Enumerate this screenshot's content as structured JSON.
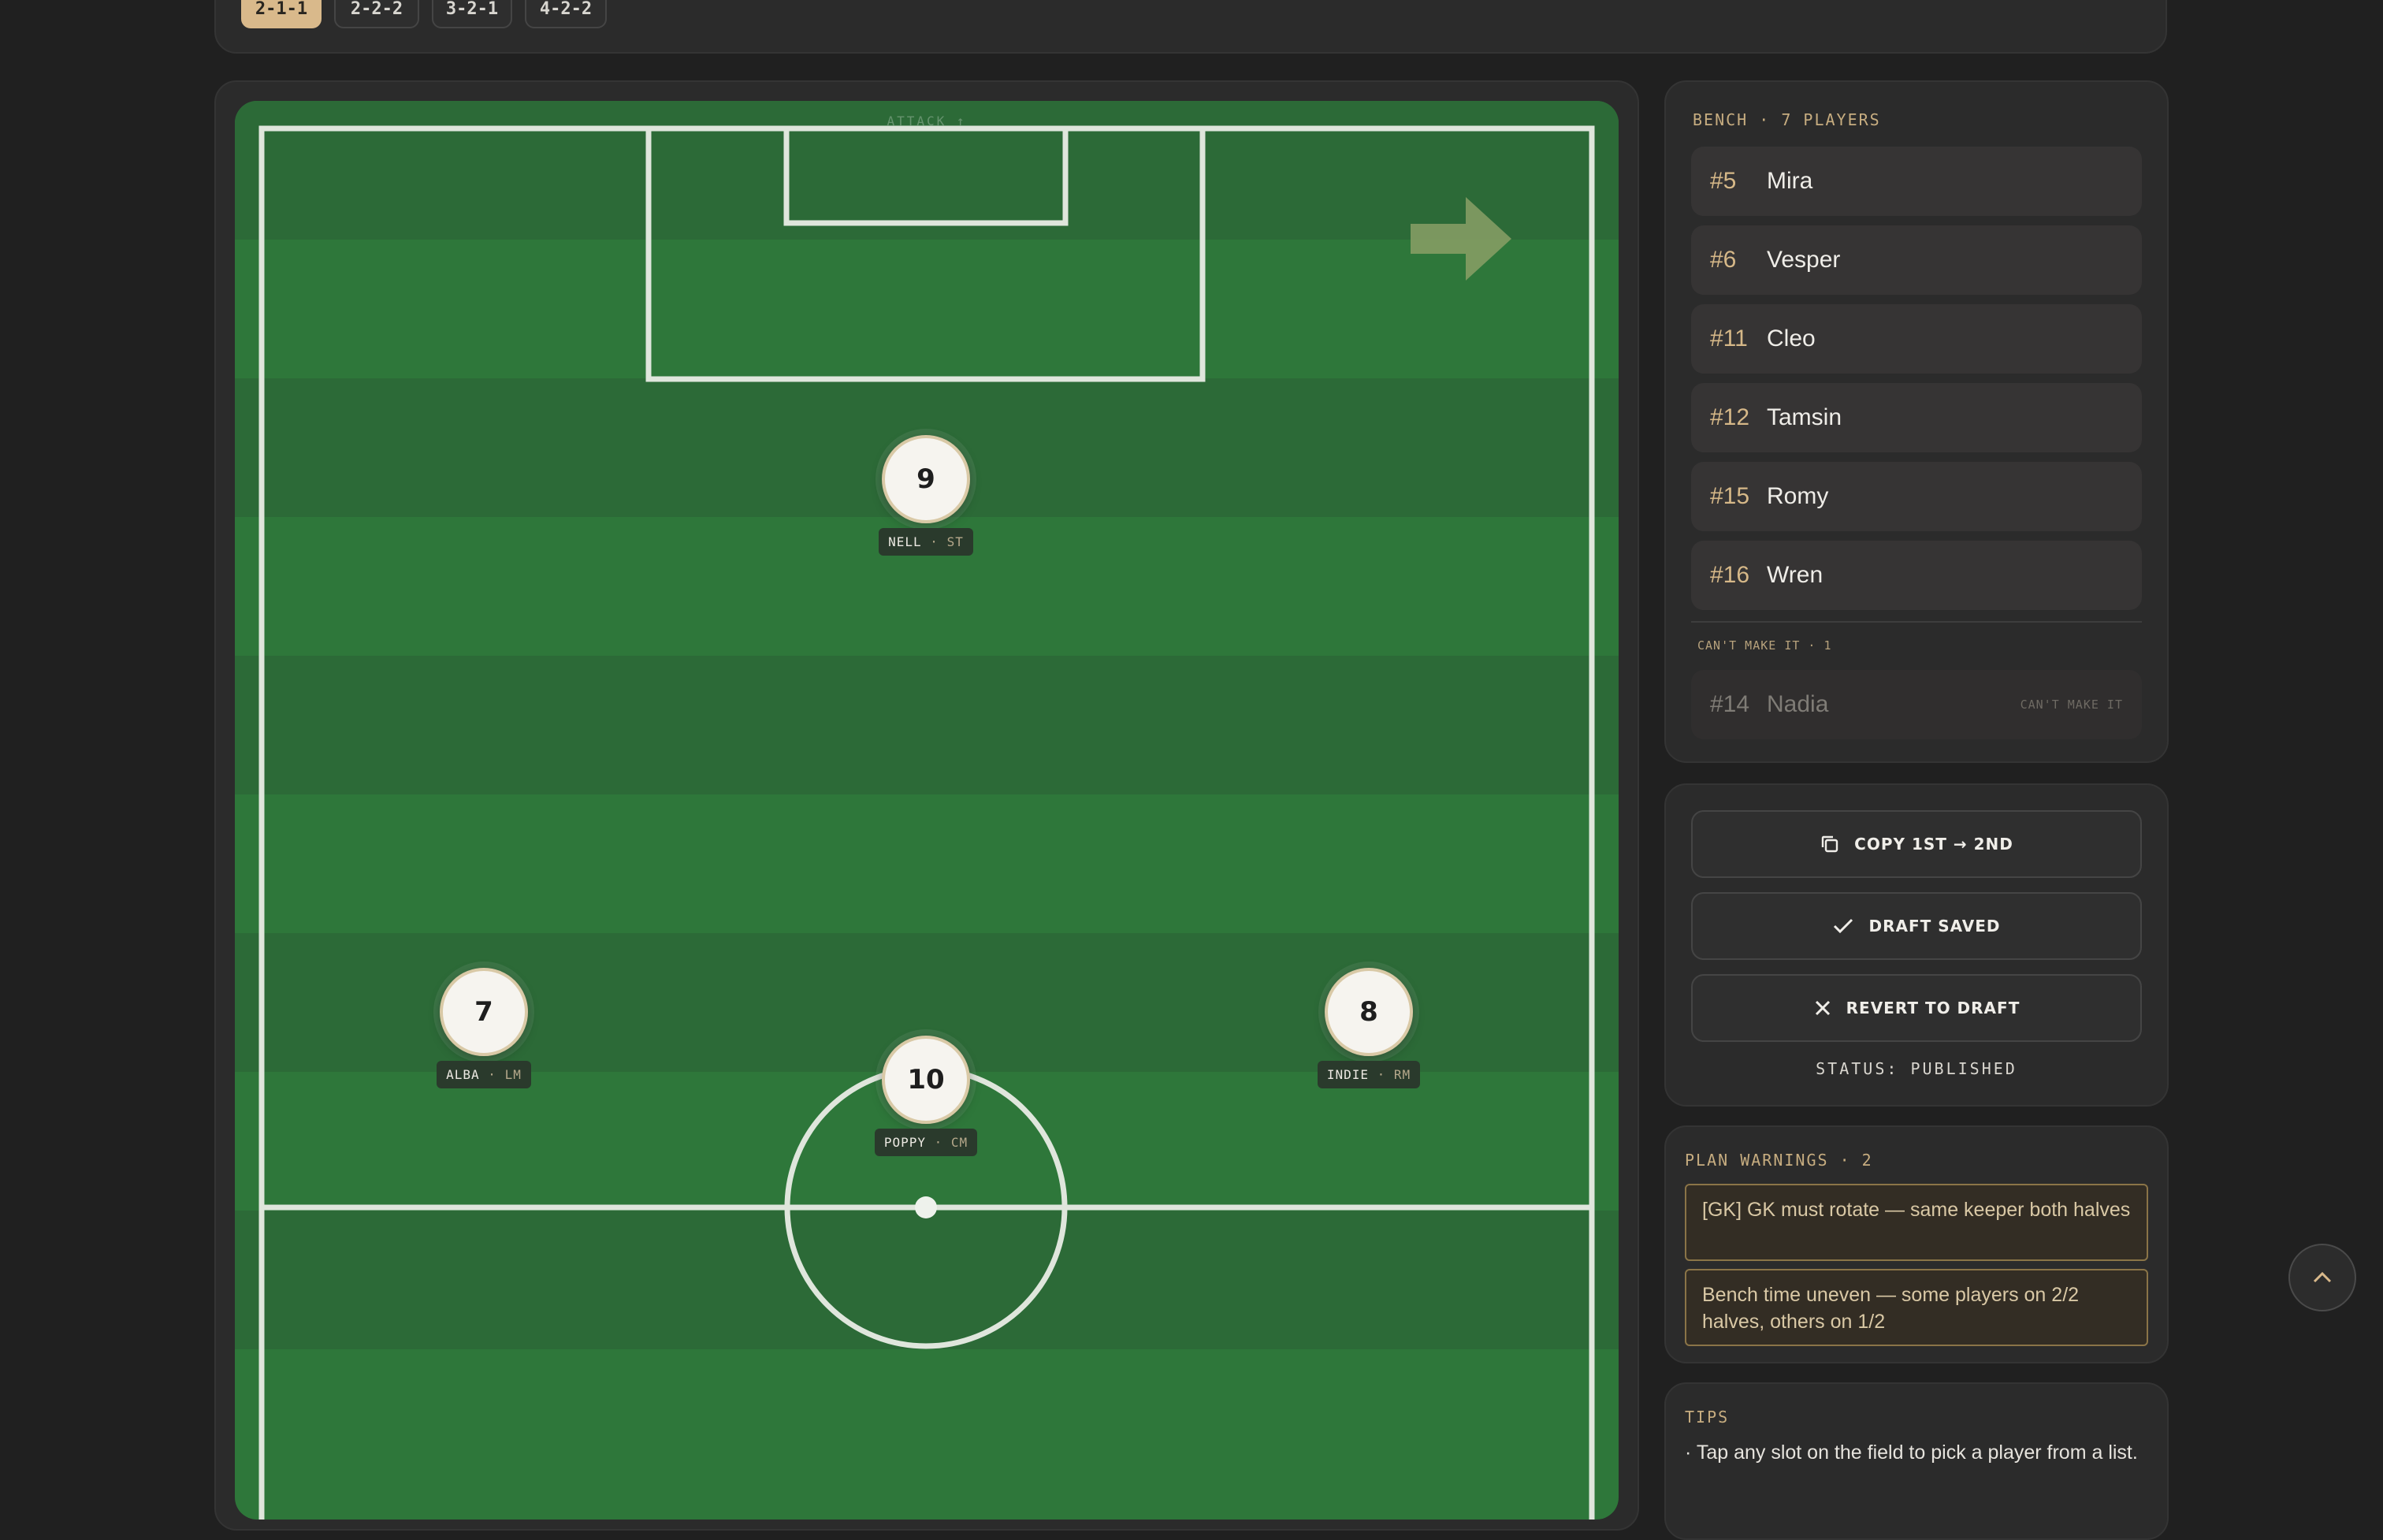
{
  "tabs": [
    {
      "label": "2-1-1"
    },
    {
      "label": "2-2-2"
    },
    {
      "label": "3-2-1"
    },
    {
      "label": "4-2-2"
    }
  ],
  "pitch": {
    "attack_label": "ATTACK ↑",
    "players": [
      {
        "number": "9",
        "name": "NELL",
        "position": "ST"
      },
      {
        "number": "7",
        "name": "ALBA",
        "position": "LM"
      },
      {
        "number": "8",
        "name": "INDIE",
        "position": "RM"
      },
      {
        "number": "10",
        "name": "POPPY",
        "position": "CM"
      }
    ],
    "separator": " · "
  },
  "bench": {
    "title": "BENCH · 7 PLAYERS",
    "players": [
      {
        "number": "#5",
        "name": "Mira"
      },
      {
        "number": "#6",
        "name": "Vesper"
      },
      {
        "number": "#11",
        "name": "Cleo"
      },
      {
        "number": "#12",
        "name": "Tamsin"
      },
      {
        "number": "#15",
        "name": "Romy"
      },
      {
        "number": "#16",
        "name": "Wren"
      }
    ],
    "unavailable_title": "CAN'T MAKE IT · 1",
    "unavailable": [
      {
        "number": "#14",
        "name": "Nadia",
        "tag": "CAN'T MAKE IT"
      }
    ]
  },
  "actions": {
    "copy_label": "COPY 1ST → 2ND",
    "draft_label": "DRAFT SAVED",
    "revert_label": "REVERT TO DRAFT",
    "status": "STATUS: PUBLISHED"
  },
  "warnings": {
    "title": "PLAN WARNINGS · 2",
    "items": [
      "[GK] GK must rotate — same keeper both halves",
      "Bench time uneven — some players on 2/2 halves, others on 1/2"
    ]
  },
  "tips": {
    "title": "TIPS",
    "text": "· Tap any slot on the field to pick a player from a list."
  },
  "colors": {
    "accent": "#d9b98b",
    "pitch_green": "#2e773a",
    "pitch_stripe": "#2c6a37",
    "warning_border": "#8a7447"
  },
  "icons": {
    "copy": "copy-icon",
    "check": "check-icon",
    "close": "close-icon",
    "scroll_top": "chevron-up-icon",
    "attack_direction": "arrow-right-icon"
  }
}
